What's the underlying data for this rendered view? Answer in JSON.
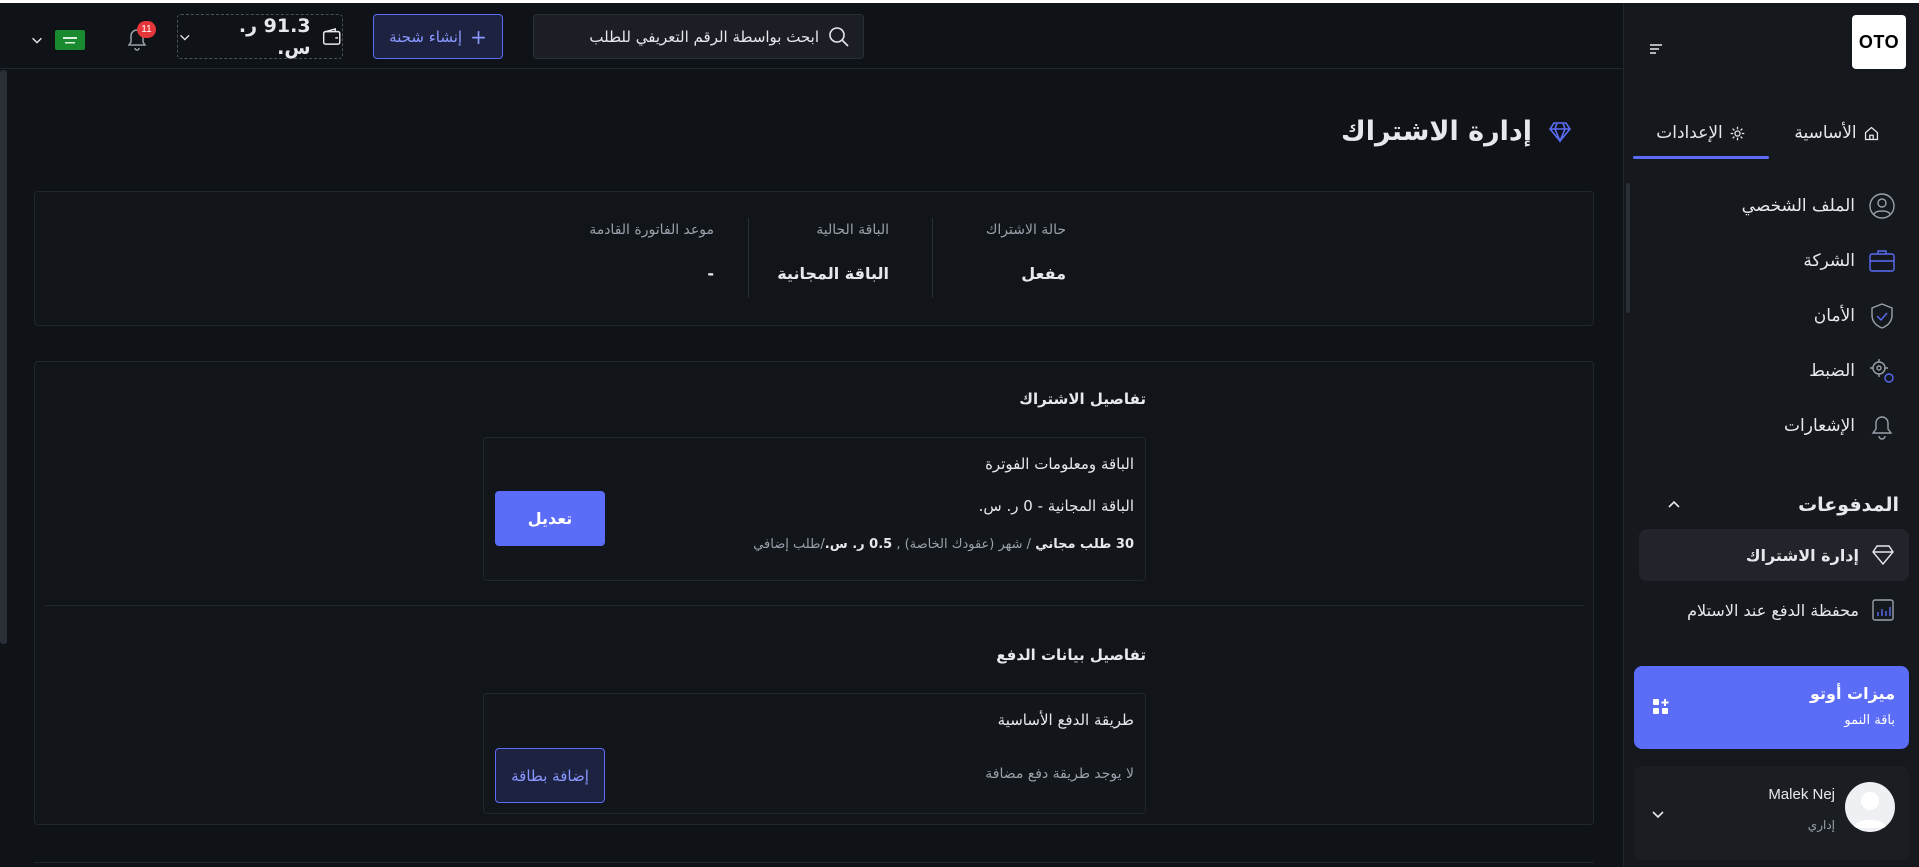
{
  "app": {
    "logo_text": "OTO"
  },
  "sidebar": {
    "tabs": [
      {
        "label": "الأساسية",
        "icon": "home-icon"
      },
      {
        "label": "الإعدادات",
        "icon": "gear-icon",
        "active": true
      }
    ],
    "items": [
      {
        "label": "الملف الشخصي",
        "icon": "user-circle-icon"
      },
      {
        "label": "الشركة",
        "icon": "briefcase-icon"
      },
      {
        "label": "الأمان",
        "icon": "shield-check-icon"
      },
      {
        "label": "الضبط",
        "icon": "gears-icon"
      },
      {
        "label": "الإشعارات",
        "icon": "bell-icon"
      }
    ],
    "payments_section": {
      "title": "المدفوعات",
      "items": [
        {
          "label": "إدارة الاشتراك",
          "icon": "diamond-icon",
          "active": true
        },
        {
          "label": "محفظة الدفع عند الاستلام",
          "icon": "wallet-chart-icon"
        }
      ]
    },
    "promo": {
      "title": "ميزات أوتو",
      "subtitle": "باقة النمو",
      "icon": "apps-add-icon"
    },
    "user": {
      "name": "Malek Nej",
      "role": "إداري"
    }
  },
  "topbar": {
    "search": {
      "placeholder": "ابحث بواسطة الرقم التعريفي للطلب"
    },
    "create_shipment_label": "إنشاء شحنة",
    "wallet_amount": "91.3 ر. س.",
    "notifications_count": "11",
    "colors": {
      "accent": "#5b6cf6",
      "badge": "#e5373b",
      "flag": "#1a8a2e"
    }
  },
  "main": {
    "title": "إدارة الاشتراك",
    "status": {
      "subscription_status_label": "حالة الاشتراك",
      "subscription_status_value": "مفعل",
      "current_plan_label": "الباقة الحالية",
      "current_plan_value": "الباقة المجانية",
      "next_invoice_label": "موعد الفاتورة القادمة",
      "next_invoice_value": "-"
    },
    "subscription_details": {
      "heading": "تفاصيل الاشتراك",
      "box_title": "الباقة ومعلومات الفوترة",
      "plan_line": "الباقة المجانية - 0 ر. س.",
      "free_orders": "30 طلب مجاني",
      "per_month": "/ شهر (عقودك الخاصة) ,",
      "extra_price": "0.5 ر. س.",
      "per_extra_order": "/طلب إضافي",
      "edit_label": "تعديل"
    },
    "payment_details": {
      "heading": "تفاصيل بيانات الدفع",
      "box_title": "طريقة الدفع الأساسية",
      "empty_text": "لا يوجد طريقة دفع مضافة",
      "add_card_label": "إضافة بطاقة"
    }
  }
}
